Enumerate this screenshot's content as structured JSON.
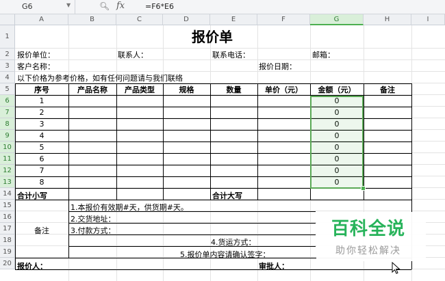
{
  "formula_bar": {
    "name_box": "G6",
    "fx_label": "fx",
    "formula": "=F6*E6"
  },
  "columns": [
    "A",
    "B",
    "C",
    "D",
    "E",
    "F",
    "G",
    "H",
    "I"
  ],
  "rows": [
    "1",
    "2",
    "3",
    "4",
    "5",
    "6",
    "7",
    "8",
    "9",
    "10",
    "11",
    "12",
    "13",
    "14",
    "15",
    "16",
    "17",
    "18",
    "19",
    "20"
  ],
  "sheet": {
    "title": "报价单",
    "quote_unit_label": "报价单位：",
    "contact_label": "联系人：",
    "phone_label": "联系电话：",
    "email_label": "邮箱：",
    "customer_label": "客户名称：",
    "quote_date_label": "报价日期：",
    "note_line": "以下价格为参考价格，如有任何问题请与我们联络",
    "headers": [
      "序号",
      "产品名称",
      "产品类型",
      "规格",
      "数量",
      "单价（元）",
      "金额（元）",
      "备注"
    ],
    "items": [
      {
        "no": "1",
        "amount": "0"
      },
      {
        "no": "2",
        "amount": "0"
      },
      {
        "no": "3",
        "amount": "0"
      },
      {
        "no": "4",
        "amount": "0"
      },
      {
        "no": "5",
        "amount": "0"
      },
      {
        "no": "6",
        "amount": "0"
      },
      {
        "no": "7",
        "amount": "0"
      },
      {
        "no": "8",
        "amount": "0"
      }
    ],
    "subtotal_lower": "合计小写",
    "subtotal_upper": "合计大写",
    "remarks_label": "备注",
    "remarks": [
      "1.本报价有效期#天，供货期#天。",
      "2.交货地址：",
      "3.付款方式：",
      "4.货运方式：",
      "5.报价单内容请确认签字："
    ],
    "quoter_label": "报价人：",
    "approver_label": "审批人："
  },
  "watermark": {
    "title": "百科全说",
    "subtitle": "助你轻松解决"
  },
  "colors": {
    "selection": "#4caf50",
    "watermark_green": "#27b35a"
  }
}
